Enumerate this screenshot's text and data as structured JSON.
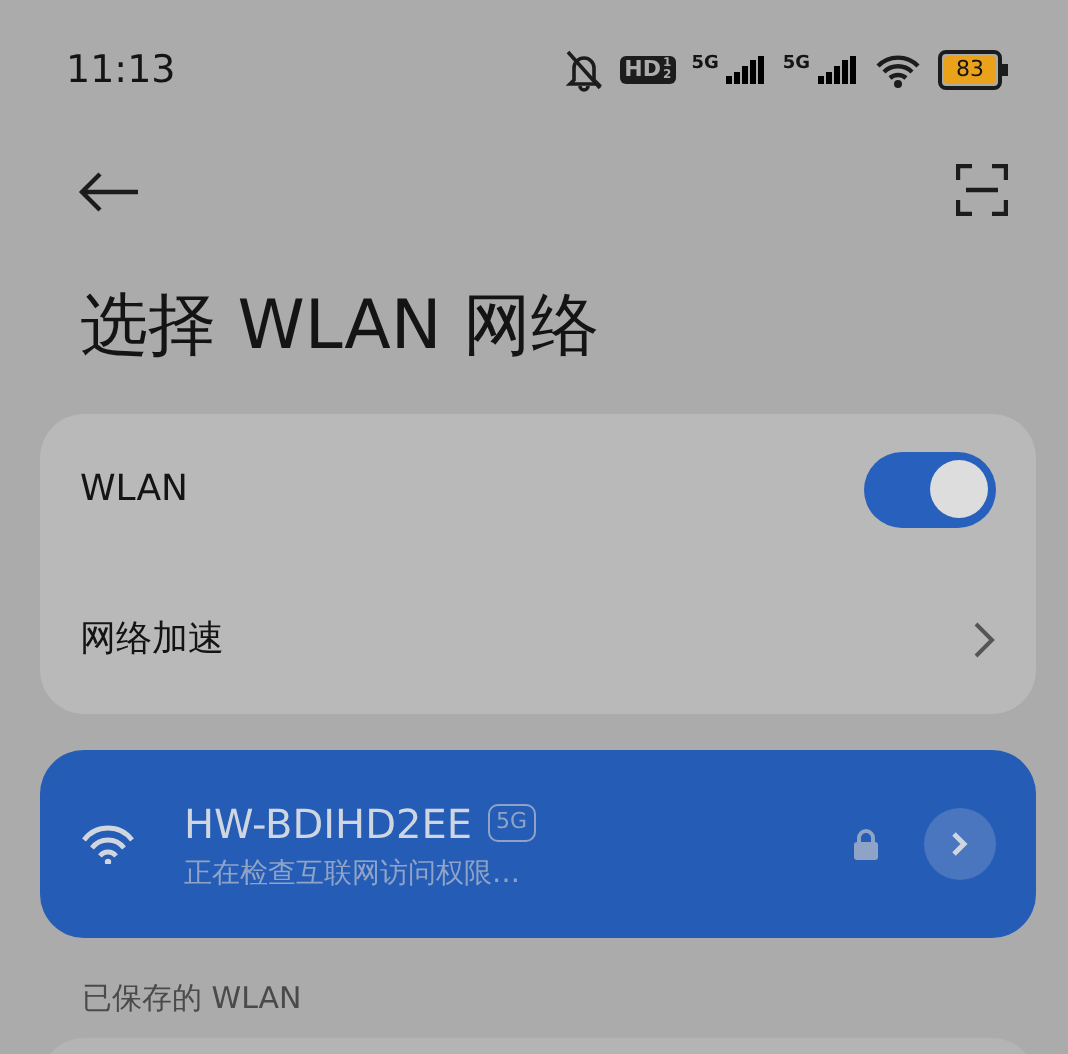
{
  "status_bar": {
    "time": "11:13",
    "hd_label": "HD",
    "hd_slots": [
      "1",
      "2"
    ],
    "signals": [
      {
        "label": "5G"
      },
      {
        "label": "5G"
      }
    ],
    "battery": "83"
  },
  "title": "选择 WLAN 网络",
  "settings": [
    {
      "kind": "toggle",
      "label": "WLAN",
      "on": true
    },
    {
      "kind": "link",
      "label": "网络加速"
    }
  ],
  "current_network": {
    "name": "HW-BDIHD2EE",
    "band": "5G",
    "status": "正在检查互联网访问权限…",
    "locked": true
  },
  "saved_section": {
    "title": "已保存的 WLAN"
  }
}
